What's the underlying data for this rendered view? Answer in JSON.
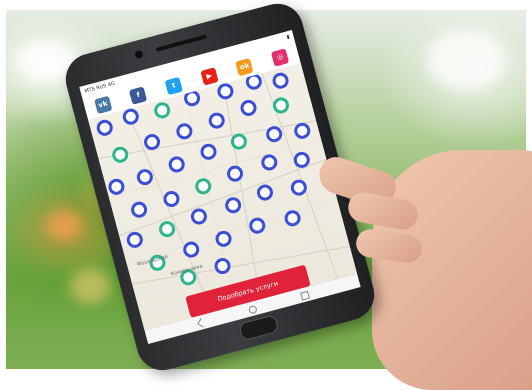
{
  "screen": {
    "status": {
      "carrier": "MTS RUS 4G",
      "time": "",
      "battery": ""
    },
    "social": [
      {
        "icon": "vk-icon",
        "glyph": "vk",
        "color": "#4a76a8"
      },
      {
        "icon": "facebook-icon",
        "glyph": "f",
        "color": "#3b5998"
      },
      {
        "icon": "twitter-icon",
        "glyph": "t",
        "color": "#1da1f2"
      },
      {
        "icon": "youtube-icon",
        "glyph": "▶",
        "color": "#e62117"
      },
      {
        "icon": "odnoklassniki-icon",
        "glyph": "ok",
        "color": "#f59a1a"
      },
      {
        "icon": "instagram-icon",
        "glyph": "◎",
        "color": "#e1306c"
      }
    ],
    "map": {
      "labels": [
        "Московский",
        "Коммунарка"
      ],
      "marker_colors": {
        "primary": "#3a4fd6",
        "secondary": "#2fb58c"
      }
    },
    "cta_label": "Подобрать услуги",
    "accent_color": "#e0223a"
  }
}
